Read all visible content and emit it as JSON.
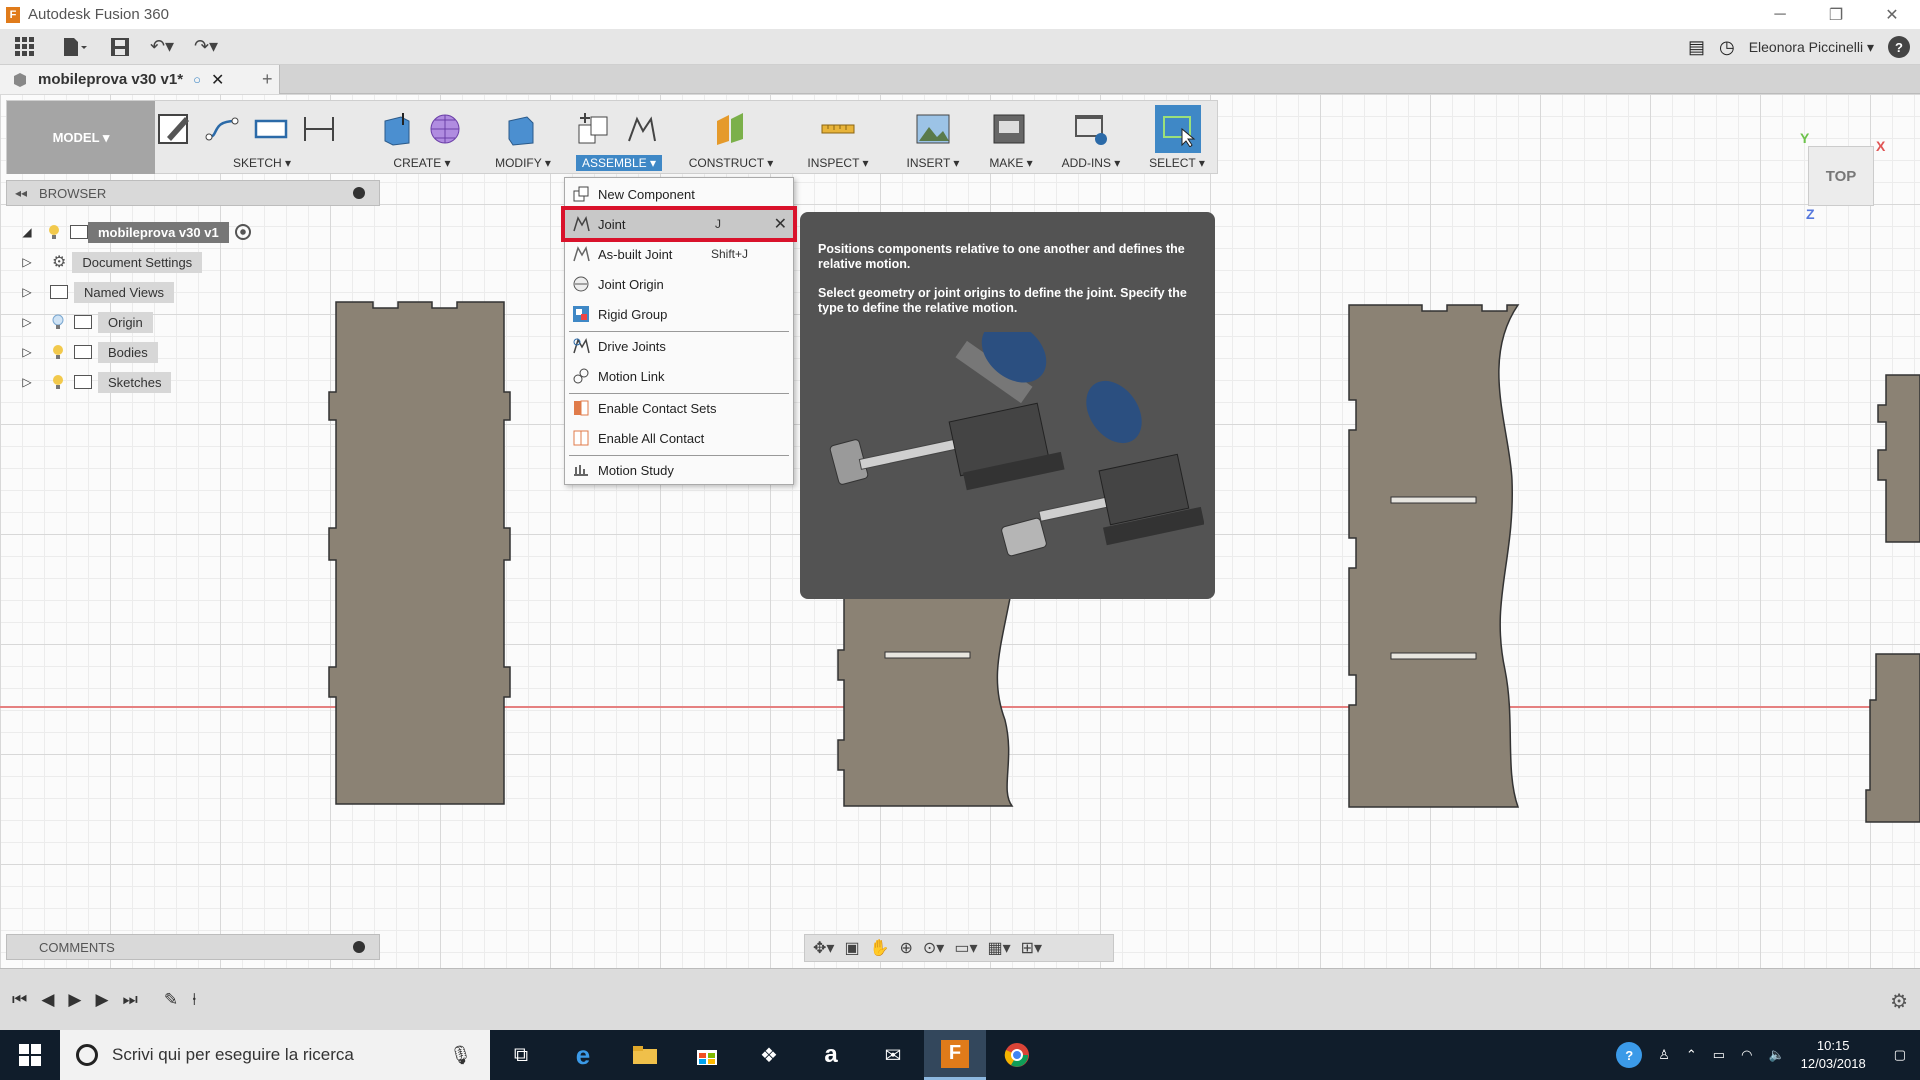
{
  "window": {
    "title": "Autodesk Fusion 360",
    "minimize": "─",
    "maximize": "❐",
    "close": "✕"
  },
  "qat": {
    "user_name": "Eleonora Piccinelli ▾",
    "help": "?"
  },
  "document_tab": {
    "title": "mobileprova v30 v1*",
    "add": "+"
  },
  "ribbon": {
    "workspace": "MODEL ▾",
    "groups": [
      {
        "label": "SKETCH ▾"
      },
      {
        "label": "CREATE ▾"
      },
      {
        "label": "MODIFY ▾"
      },
      {
        "label": "ASSEMBLE ▾"
      },
      {
        "label": "CONSTRUCT ▾"
      },
      {
        "label": "INSPECT ▾"
      },
      {
        "label": "INSERT ▾"
      },
      {
        "label": "MAKE ▾"
      },
      {
        "label": "ADD-INS ▾"
      },
      {
        "label": "SELECT ▾"
      }
    ],
    "colors": {
      "active": "#3f88c6"
    }
  },
  "browser": {
    "title": "BROWSER",
    "root": "mobileprova v30 v1",
    "items": [
      {
        "label": "Document Settings",
        "icon": "gear-icon"
      },
      {
        "label": "Named Views",
        "icon": "folder-icon"
      },
      {
        "label": "Origin",
        "icon": "folder-icon"
      },
      {
        "label": "Bodies",
        "icon": "folder-icon"
      },
      {
        "label": "Sketches",
        "icon": "folder-icon"
      }
    ]
  },
  "assemble_menu": {
    "items": [
      {
        "label": "New Component",
        "shortcut": ""
      },
      {
        "label": "Joint",
        "shortcut": "J"
      },
      {
        "label": "As-built Joint",
        "shortcut": "Shift+J"
      },
      {
        "label": "Joint Origin",
        "shortcut": ""
      },
      {
        "label": "Rigid Group",
        "shortcut": ""
      },
      {
        "label": "Drive Joints",
        "shortcut": ""
      },
      {
        "label": "Motion Link",
        "shortcut": ""
      },
      {
        "label": "Enable Contact Sets",
        "shortcut": ""
      },
      {
        "label": "Enable All Contact",
        "shortcut": ""
      },
      {
        "label": "Motion Study",
        "shortcut": ""
      }
    ],
    "highlight_color": "#d9122b"
  },
  "tooltip": {
    "line1": "Positions components relative to one another and defines the relative motion.",
    "line2": "Select geometry or joint origins to define the joint. Specify the type to define the relative motion."
  },
  "viewcube": {
    "face": "TOP",
    "x": "X",
    "y": "Y",
    "z": "Z"
  },
  "comments": {
    "title": "COMMENTS"
  },
  "taskbar": {
    "search_placeholder": "Scrivi qui per eseguire la ricerca",
    "time": "10:15",
    "date": "12/03/2018"
  }
}
